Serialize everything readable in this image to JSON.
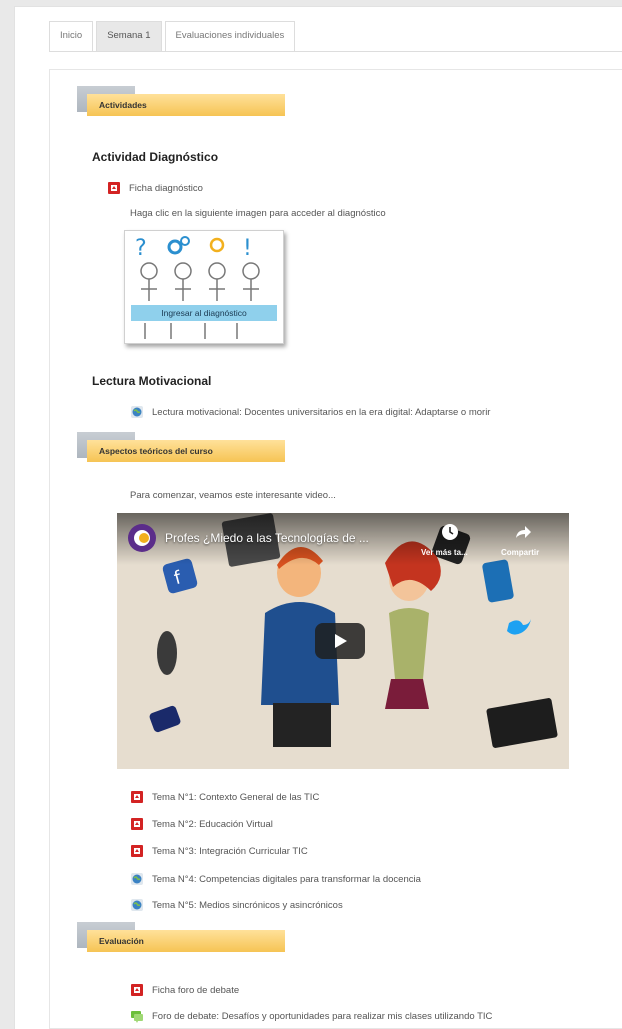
{
  "tabs": [
    {
      "label": "Inicio",
      "active": false
    },
    {
      "label": "Semana 1",
      "active": true
    },
    {
      "label": "Evaluaciones individuales",
      "active": false
    }
  ],
  "sections": {
    "actividades": "Actividades",
    "aspectos": "Aspectos teóricos del curso",
    "evaluacion": "Evaluación"
  },
  "diagnostico": {
    "heading": "Actividad Diagnóstico",
    "ficha_link": "Ficha diagnóstico",
    "instruction": "Haga clic en la siguiente imagen para acceder al diagnóstico",
    "image_label": "Ingresar al diagnóstico"
  },
  "lectura": {
    "heading": "Lectura Motivacional",
    "link": "Lectura motivacional: Docentes universitarios en la era digital: Adaptarse o morir"
  },
  "aspectos": {
    "intro": "Para comenzar, veamos este interesante video...",
    "video": {
      "title": "Profes ¿Miedo a las Tecnologías de ...",
      "watch_later": "Ver más ta...",
      "share": "Compartir"
    },
    "temas": [
      {
        "label": "Tema N°1: Contexto General de las TIC",
        "icon": "pdf-icon"
      },
      {
        "label": "Tema N°2: Educación Virtual",
        "icon": "pdf-icon"
      },
      {
        "label": "Tema N°3: Integración Curricular TIC",
        "icon": "pdf-icon"
      },
      {
        "label": "Tema N°4: Competencias digitales para transformar la docencia",
        "icon": "url-globe-icon"
      },
      {
        "label": "Tema N°5: Medios sincrónicos y asincrónicos",
        "icon": "url-globe-icon"
      }
    ]
  },
  "evaluacion": {
    "ficha_foro": "Ficha foro de debate",
    "foro": "Foro de debate: Desafíos y oportunidades para realizar mis clases utilizando TIC"
  },
  "colors": {
    "section_bar": "#f6c454",
    "pdf_red": "#d32323",
    "globe_blue": "#3b82c4",
    "forum_green": "#6cbf3c"
  }
}
